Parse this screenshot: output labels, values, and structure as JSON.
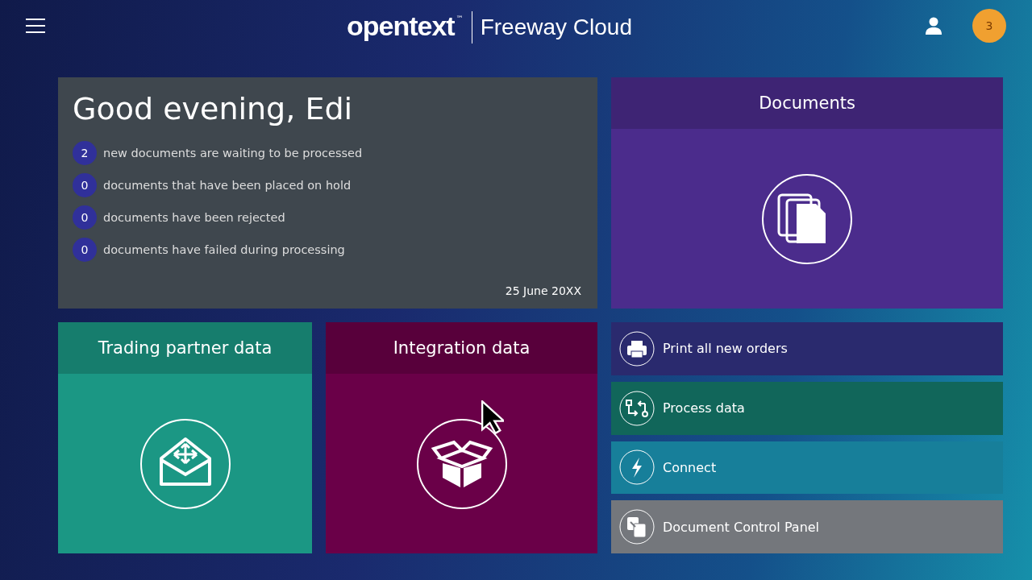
{
  "header": {
    "logo": "opentext",
    "trademark": "™",
    "product": "Freeway Cloud",
    "notification_count": "3"
  },
  "welcome": {
    "greeting": "Good evening, Edi",
    "stats": [
      {
        "count": "2",
        "text": "new documents are waiting to be processed"
      },
      {
        "count": "0",
        "text": "documents that have been placed on hold"
      },
      {
        "count": "0",
        "text": "documents have been rejected"
      },
      {
        "count": "0",
        "text": "documents have failed during processing"
      }
    ],
    "date": "25 June 20XX"
  },
  "tiles": [
    {
      "kind": "documents",
      "title": "Documents",
      "color": "#4b2c8c"
    },
    {
      "kind": "trading",
      "title": "Trading partner data",
      "color": "#1b9784"
    },
    {
      "kind": "integration",
      "title": "Integration data",
      "color": "#6a0048"
    }
  ],
  "actions": [
    {
      "kind": "print",
      "label": "Print all new orders",
      "color": "#2a2a6e"
    },
    {
      "kind": "process",
      "label": "Process data",
      "color": "#11665a"
    },
    {
      "kind": "connect",
      "label": "Connect",
      "color": "#177f9a"
    },
    {
      "kind": "control",
      "label": "Document Control Panel",
      "color": "#74777c"
    }
  ]
}
